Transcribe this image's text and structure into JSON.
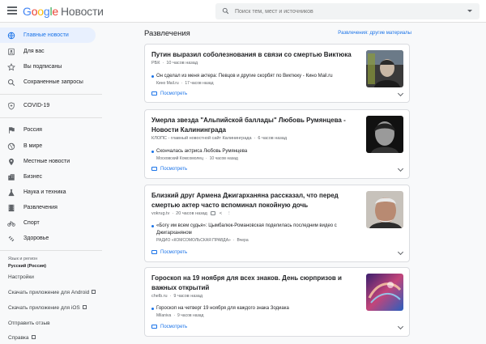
{
  "header": {
    "logo_brand": "Google",
    "logo_product": "Новости",
    "search_placeholder": "Поиск тем, мест и источников"
  },
  "sidebar": {
    "items": [
      {
        "label": "Главные новости",
        "icon": "home-icon",
        "active": true
      },
      {
        "label": "Для вас",
        "icon": "person-icon"
      },
      {
        "label": "Вы подписаны",
        "icon": "star-icon"
      },
      {
        "label": "Сохраненные запросы",
        "icon": "search-icon"
      },
      {
        "label": "COVID-19",
        "icon": "shield-icon"
      },
      {
        "label": "Россия",
        "icon": "flag-icon"
      },
      {
        "label": "В мире",
        "icon": "globe-icon"
      },
      {
        "label": "Местные новости",
        "icon": "location-pin-icon"
      },
      {
        "label": "Бизнес",
        "icon": "building-icon"
      },
      {
        "label": "Наука и техника",
        "icon": "flask-icon"
      },
      {
        "label": "Развлечения",
        "icon": "film-icon"
      },
      {
        "label": "Спорт",
        "icon": "bicycle-icon"
      },
      {
        "label": "Здоровье",
        "icon": "dumbbell-icon"
      }
    ],
    "language_title": "Язык и регион",
    "language_value": "Русский (Россия)",
    "settings": "Настройки",
    "download_android": "Скачать приложение для Android",
    "download_ios": "Скачать приложение для iOS",
    "feedback": "Отправить отзыв",
    "help": "Справка"
  },
  "main": {
    "section_title": "Развлечения",
    "section_more": "Развлечения: другие материалы",
    "cover_label": "Посмотреть",
    "articles": [
      {
        "headline": "Путин выразил соболезнования в связи со смертью Виктюка",
        "source": "РБК",
        "time": "10 часов назад",
        "sub_title": "Он сделал из меня актера: Певцов и другие скорбят по Виктюку - Кино Mail.ru",
        "sub_source": "Кино Mail.ru",
        "sub_time": "17 часов назад"
      },
      {
        "headline": "Умерла звезда \"Альпийской баллады\" Любовь Румянцева - Новости Калининграда",
        "source": "КЛОПС - главный новостной сайт Калининграда",
        "time": "6 часов назад",
        "sub_title": "Скончалась актриса Любовь Румянцева",
        "sub_source": "Московский Комсомолец",
        "sub_time": "10 часов назад"
      },
      {
        "headline": "Близкий друг Армена Джигарханяна рассказал, что перед смертью актер часто вспоминал покойную дочь",
        "source": "vokrug.tv",
        "time": "20 часов назад",
        "sub_title": "«Богу им всем судья»: Цымбалюк-Романовская поделилась последним видео с Джигарханяном",
        "sub_source": "РАДИО «КОМСОМОЛЬСКАЯ ПРАВДА»",
        "sub_time": "Вчера"
      },
      {
        "headline": "Гороскоп на 19 ноября для всех знаков. День сюрпризов и важных открытий",
        "source": "chelb.ru",
        "time": "9 часов назад",
        "sub_title": "Гороскоп на четверг 19 ноября для каждого знака Зодиака",
        "sub_source": "Milaniva",
        "sub_time": "9 часов назад"
      }
    ]
  },
  "colors": {
    "accent": "#1a73e8",
    "active_bg": "#e8f0fe"
  }
}
